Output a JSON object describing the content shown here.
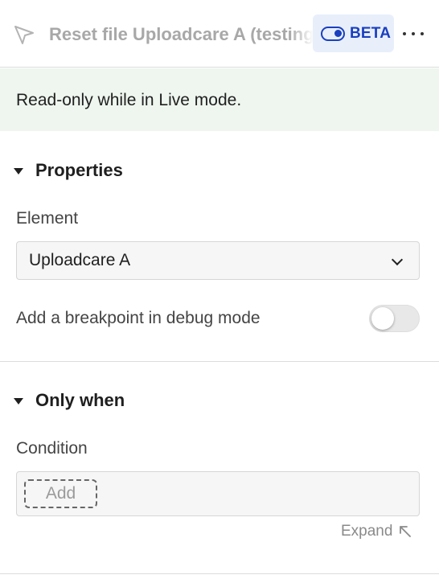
{
  "header": {
    "title": "Reset file Uploadcare A (testing)",
    "beta_label": "BETA",
    "icons": {
      "cursor": "cursor-pointer-icon",
      "toggle": "toggle-icon",
      "more": "more-dots-icon"
    }
  },
  "notice": {
    "text": "Read-only while in Live mode."
  },
  "properties": {
    "title": "Properties",
    "element_label": "Element",
    "element_value": "Uploadcare A",
    "breakpoint_label": "Add a breakpoint in debug mode",
    "breakpoint_enabled": false
  },
  "only_when": {
    "title": "Only when",
    "condition_label": "Condition",
    "add_label": "Add",
    "expand_label": "Expand"
  },
  "colors": {
    "accent": "#1a3fbf",
    "notice_bg": "#eef6ef",
    "beta_bg": "#e8effb"
  }
}
